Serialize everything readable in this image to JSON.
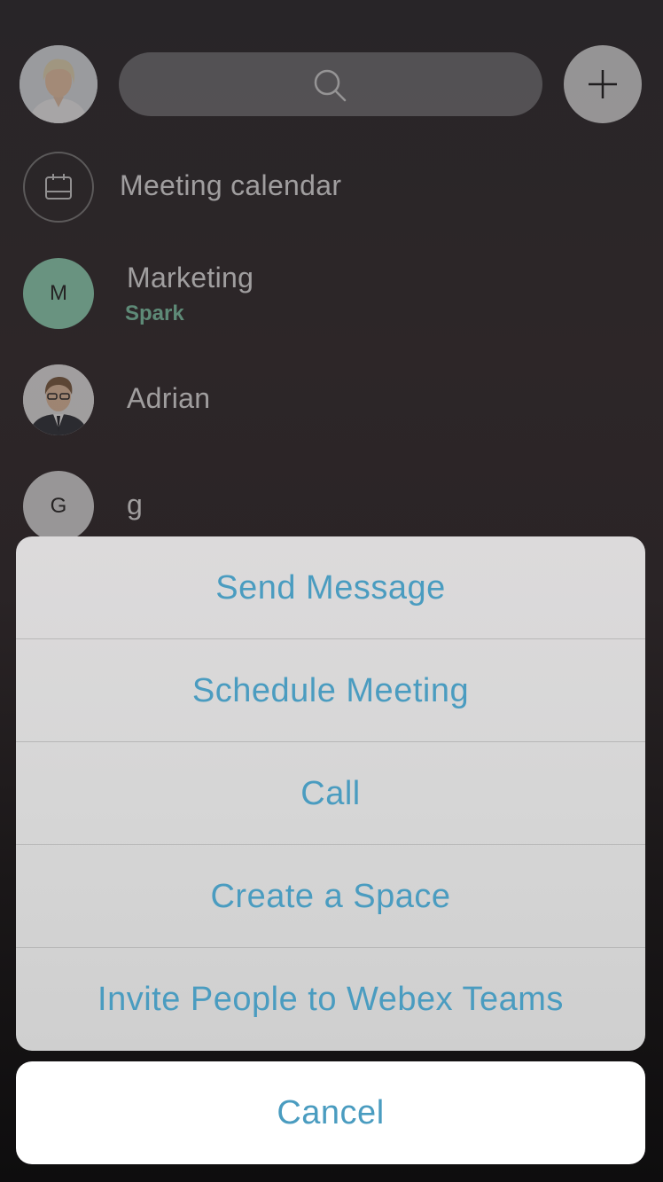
{
  "header": {
    "avatar_name": "user-avatar",
    "search_icon": "search-icon",
    "add_icon": "plus-icon"
  },
  "spaces": [
    {
      "type": "calendar",
      "title": "Meeting calendar",
      "icon": "calendar-icon"
    },
    {
      "type": "initial",
      "initial": "M",
      "title": "Marketing",
      "subtitle": "Spark",
      "color": "#8fd6b6"
    },
    {
      "type": "photo",
      "title": "Adrian"
    },
    {
      "type": "initial",
      "initial": "G",
      "title": "g",
      "color": "#dcdcdc"
    }
  ],
  "action_sheet": {
    "items": [
      "Send Message",
      "Schedule Meeting",
      "Call",
      "Create a Space",
      "Invite People to Webex Teams"
    ],
    "cancel": "Cancel",
    "accent_color": "#4a9cc0"
  }
}
